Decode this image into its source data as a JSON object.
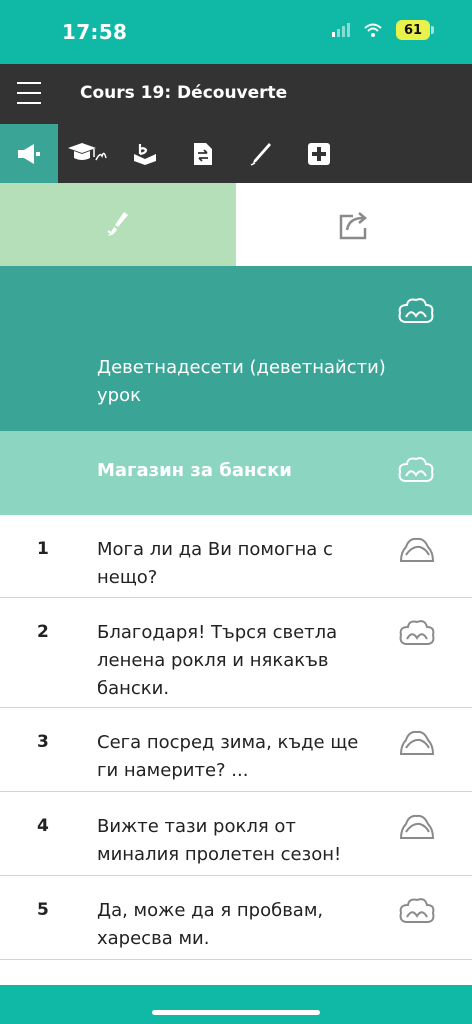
{
  "status_bar": {
    "time": "17:58",
    "battery": "61"
  },
  "header": {
    "title": "Cours 19: Découverte"
  },
  "toolbar": {
    "tools": [
      {
        "icon": "speaker-icon",
        "active": true
      },
      {
        "icon": "graduation-cap-icon",
        "active": false
      },
      {
        "icon": "vocabulary-box-icon",
        "active": false
      },
      {
        "icon": "translate-document-icon",
        "active": false
      },
      {
        "icon": "pencil-icon",
        "active": false
      },
      {
        "icon": "plus-icon",
        "active": false
      }
    ]
  },
  "modes": {
    "left_icon": "brush-icon",
    "right_icon": "repeat-icon"
  },
  "lesson": {
    "title": "Деветнадесети (деветнайсти) урок"
  },
  "section": {
    "title": "Магазин за бански"
  },
  "rows": [
    {
      "num": "1",
      "text": "Мога ли да Ви помогна с нещо?"
    },
    {
      "num": "2",
      "text": "Благодаря! Търся светла ленена рокля и някакъв бански."
    },
    {
      "num": "3",
      "text": "Сега посред зима, къде ще ги намерите? ..."
    },
    {
      "num": "4",
      "text": "Вижте тази рокля от миналия пролетен сезон!"
    },
    {
      "num": "5",
      "text": "Да, може да я пробвам, харесва ми."
    }
  ],
  "colors": {
    "teal": "#10b9a5",
    "dark": "#333333",
    "mid_teal": "#3aa596",
    "light_teal": "#8cd5c1",
    "light_green": "#b5dfb9"
  }
}
